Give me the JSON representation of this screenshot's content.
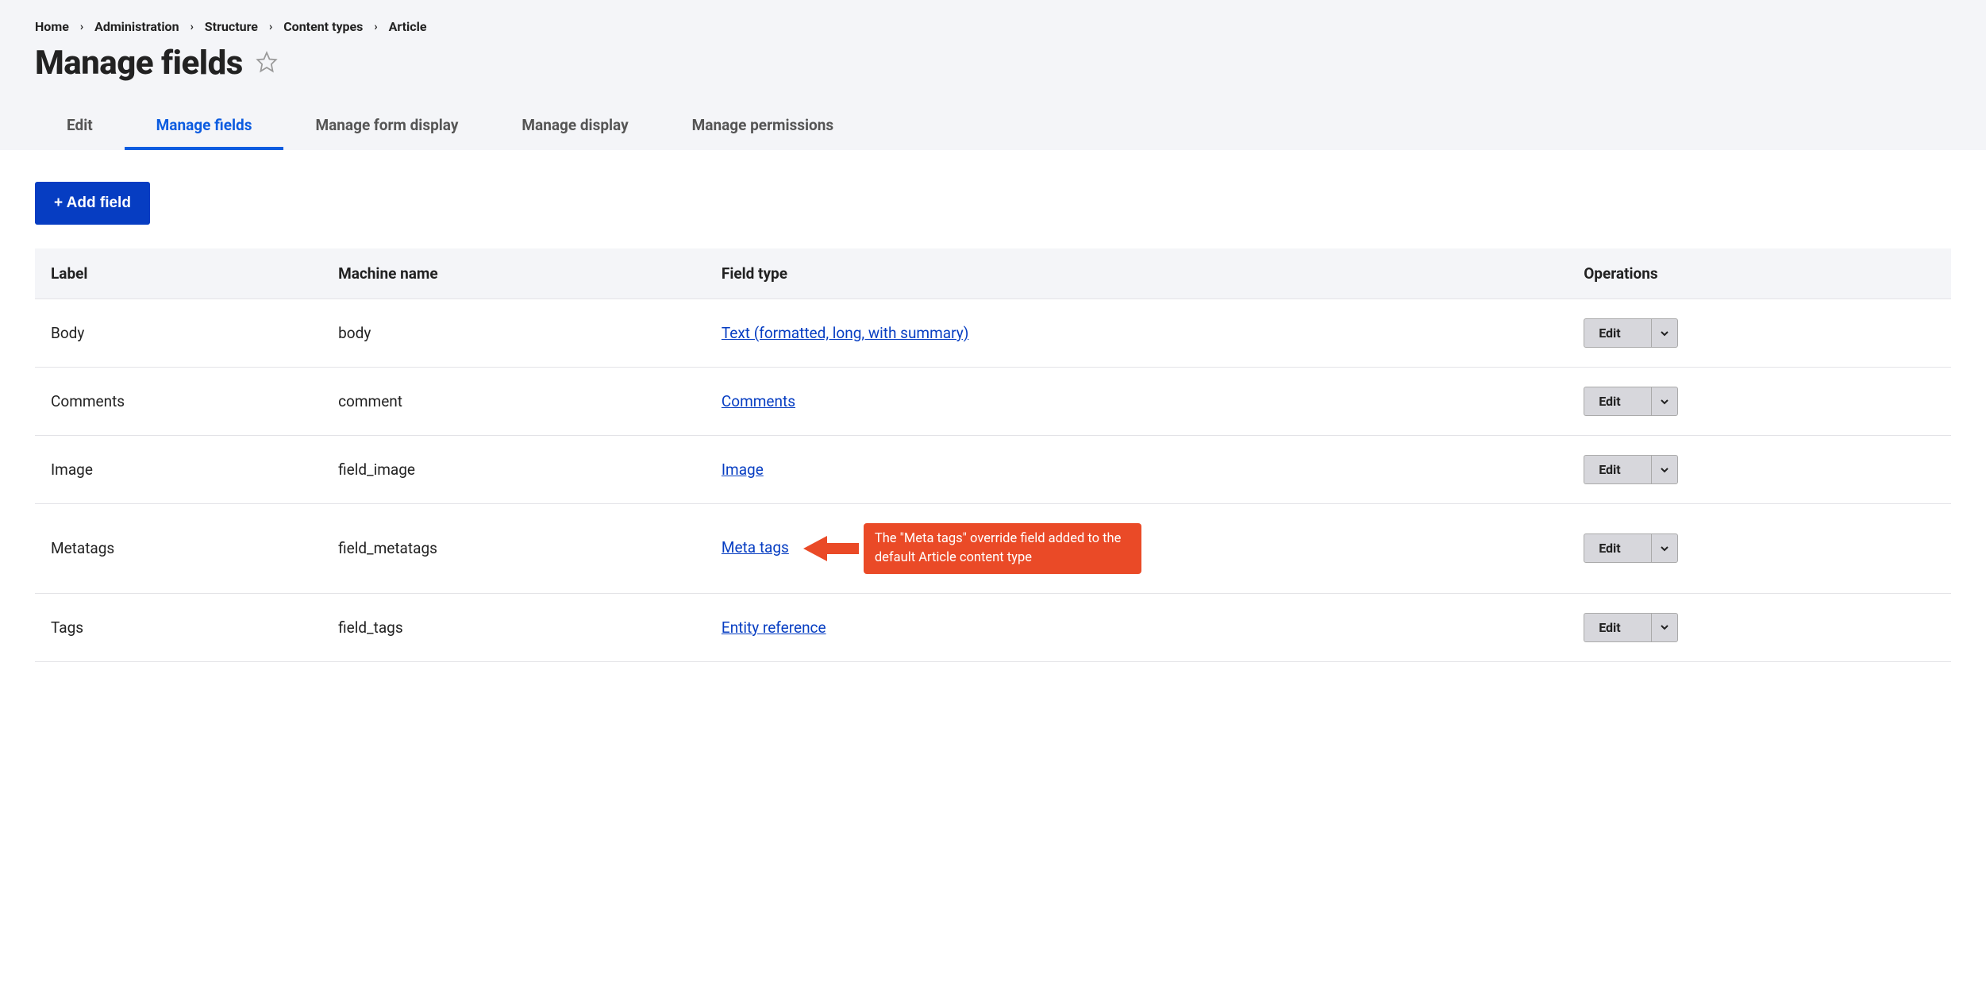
{
  "breadcrumb": [
    {
      "label": "Home"
    },
    {
      "label": "Administration"
    },
    {
      "label": "Structure"
    },
    {
      "label": "Content types"
    },
    {
      "label": "Article"
    }
  ],
  "page_title": "Manage fields",
  "tabs": [
    {
      "label": "Edit",
      "active": false
    },
    {
      "label": "Manage fields",
      "active": true
    },
    {
      "label": "Manage form display",
      "active": false
    },
    {
      "label": "Manage display",
      "active": false
    },
    {
      "label": "Manage permissions",
      "active": false
    }
  ],
  "add_button": "+ Add field",
  "table": {
    "headers": {
      "label": "Label",
      "machine": "Machine name",
      "type": "Field type",
      "ops": "Operations"
    },
    "rows": [
      {
        "label": "Body",
        "machine": "body",
        "type": "Text (formatted, long, with summary)"
      },
      {
        "label": "Comments",
        "machine": "comment",
        "type": "Comments"
      },
      {
        "label": "Image",
        "machine": "field_image",
        "type": "Image"
      },
      {
        "label": "Metatags",
        "machine": "field_metatags",
        "type": "Meta tags"
      },
      {
        "label": "Tags",
        "machine": "field_tags",
        "type": "Entity reference"
      }
    ],
    "op_label": "Edit"
  },
  "callout": "The \"Meta tags\" override field added to the default Article content type",
  "callout_row_index": 3
}
